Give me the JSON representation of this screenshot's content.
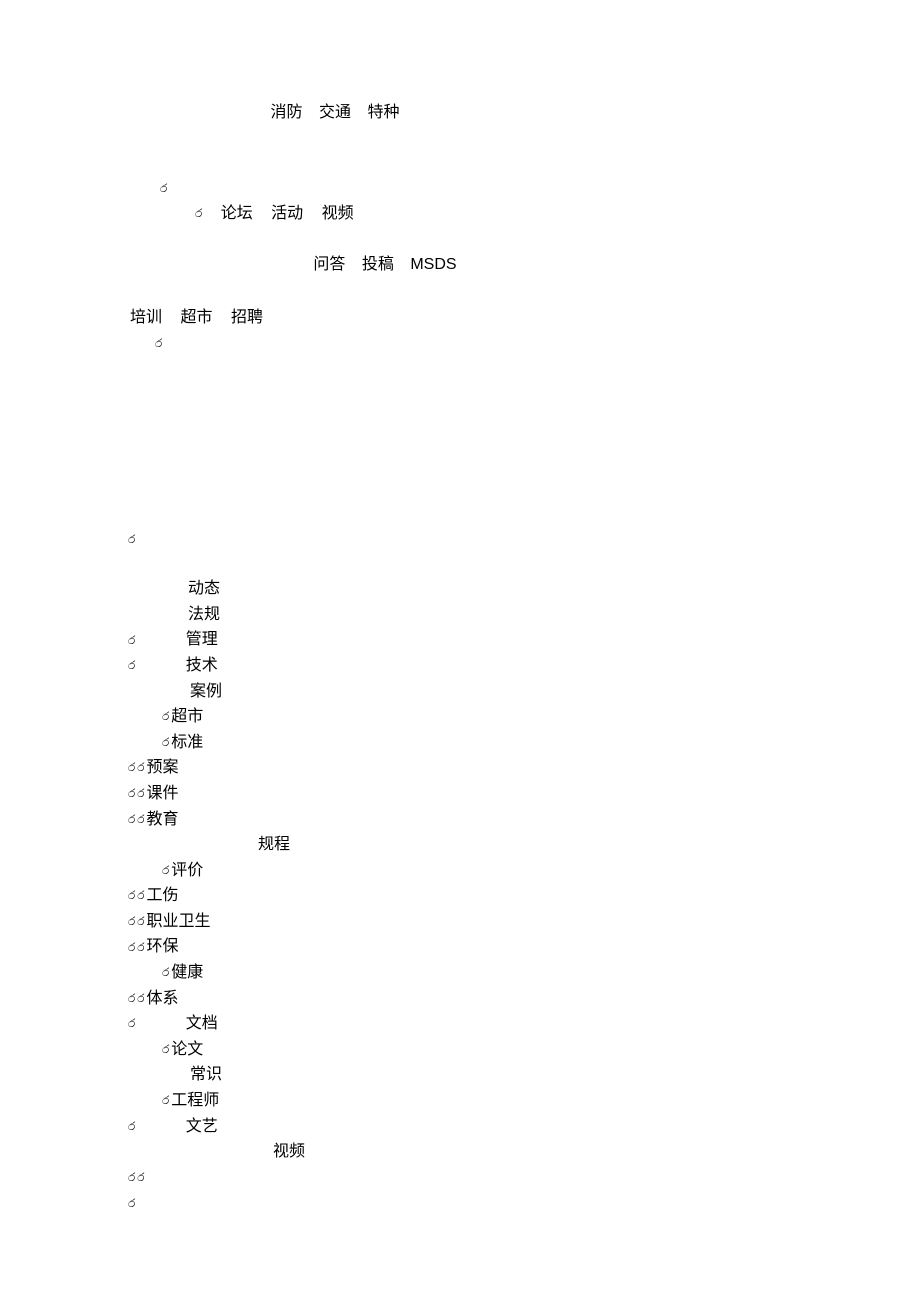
{
  "row1": {
    "a": "消防",
    "b": "交通",
    "c": "特种"
  },
  "row3": {
    "a": "论坛",
    "b": "活动",
    "c": "视频"
  },
  "row4": {
    "a": "问答",
    "b": "投稿",
    "c": "MSDS"
  },
  "row5": {
    "a": "培训",
    "b": "超市",
    "c": "招聘"
  },
  "list": {
    "l1": "动态",
    "l2": "法规",
    "l3": "管理",
    "l4": "技术",
    "l5": "案例",
    "l6": "超市",
    "l7": "标准",
    "l8": "预案",
    "l9": "课件",
    "l10": "教育",
    "l11": "规程",
    "l12": "评价",
    "l13": "工伤",
    "l14": "职业卫生",
    "l15": "环保",
    "l16": "健康",
    "l17": "体系",
    "l18": "文档",
    "l19": "论文",
    "l20": "常识",
    "l21": "工程师",
    "l22": "文艺",
    "l23": "视频"
  },
  "bullet": "෮"
}
